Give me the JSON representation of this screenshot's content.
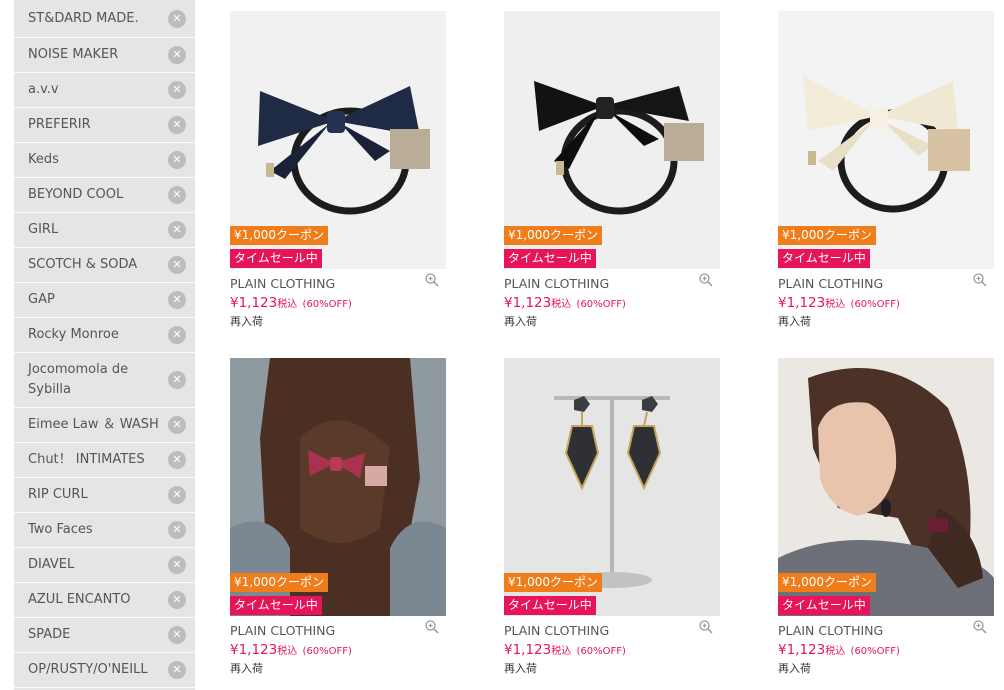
{
  "sidebar": {
    "brands": [
      {
        "label": "ST&DARD MADE."
      },
      {
        "label": "NOISE MAKER"
      },
      {
        "label": "a.v.v"
      },
      {
        "label": "PREFERIR"
      },
      {
        "label": "Keds"
      },
      {
        "label": "BEYOND COOL"
      },
      {
        "label": "GIRL"
      },
      {
        "label": "SCOTCH & SODA"
      },
      {
        "label": "GAP"
      },
      {
        "label": "Rocky Monroe"
      },
      {
        "label": "Jocomomola de Sybilla"
      },
      {
        "label": "Eimee Law ＆ WASH"
      },
      {
        "label": "Chut！ INTIMATES"
      },
      {
        "label": "RIP CURL"
      },
      {
        "label": "Two Faces"
      },
      {
        "label": "DIAVEL"
      },
      {
        "label": "AZUL ENCANTO"
      },
      {
        "label": "SPADE"
      },
      {
        "label": "OP/RUSTY/O'NEILL"
      }
    ],
    "remove_glyph": "✕"
  },
  "products": [
    {
      "image": "navy-bow-hair-tie",
      "coupon": "¥1,000クーポン",
      "sale": "タイムセール中",
      "brand": "PLAIN CLOTHING",
      "price": "¥1,123",
      "tax": "税込",
      "off": "(60%OFF)",
      "status": "再入荷"
    },
    {
      "image": "black-bow-hair-tie",
      "coupon": "¥1,000クーポン",
      "sale": "タイムセール中",
      "brand": "PLAIN CLOTHING",
      "price": "¥1,123",
      "tax": "税込",
      "off": "(60%OFF)",
      "status": "再入荷"
    },
    {
      "image": "ivory-bow-hair-tie",
      "coupon": "¥1,000クーポン",
      "sale": "タイムセール中",
      "brand": "PLAIN CLOTHING",
      "price": "¥1,123",
      "tax": "税込",
      "off": "(60%OFF)",
      "status": "再入荷"
    },
    {
      "image": "model-with-pink-bow",
      "coupon": "¥1,000クーポン",
      "sale": "タイムセール中",
      "brand": "PLAIN CLOTHING",
      "price": "¥1,123",
      "tax": "税込",
      "off": "(60%OFF)",
      "status": "再入荷"
    },
    {
      "image": "drop-earrings-on-stand",
      "coupon": "¥1,000クーポン",
      "sale": "タイムセール中",
      "brand": "PLAIN CLOTHING",
      "price": "¥1,123",
      "tax": "税込",
      "off": "(60%OFF)",
      "status": "再入荷"
    },
    {
      "image": "model-side-profile",
      "coupon": "¥1,000クーポン",
      "sale": "タイムセール中",
      "brand": "PLAIN CLOTHING",
      "price": "¥1,123",
      "tax": "税込",
      "off": "(60%OFF)",
      "status": "再入荷"
    }
  ],
  "colors": {
    "coupon_badge": "#f07d1c",
    "sale_badge": "#e6155a",
    "price": "#e6155a",
    "sidebar_bg": "#e5e5e5"
  }
}
